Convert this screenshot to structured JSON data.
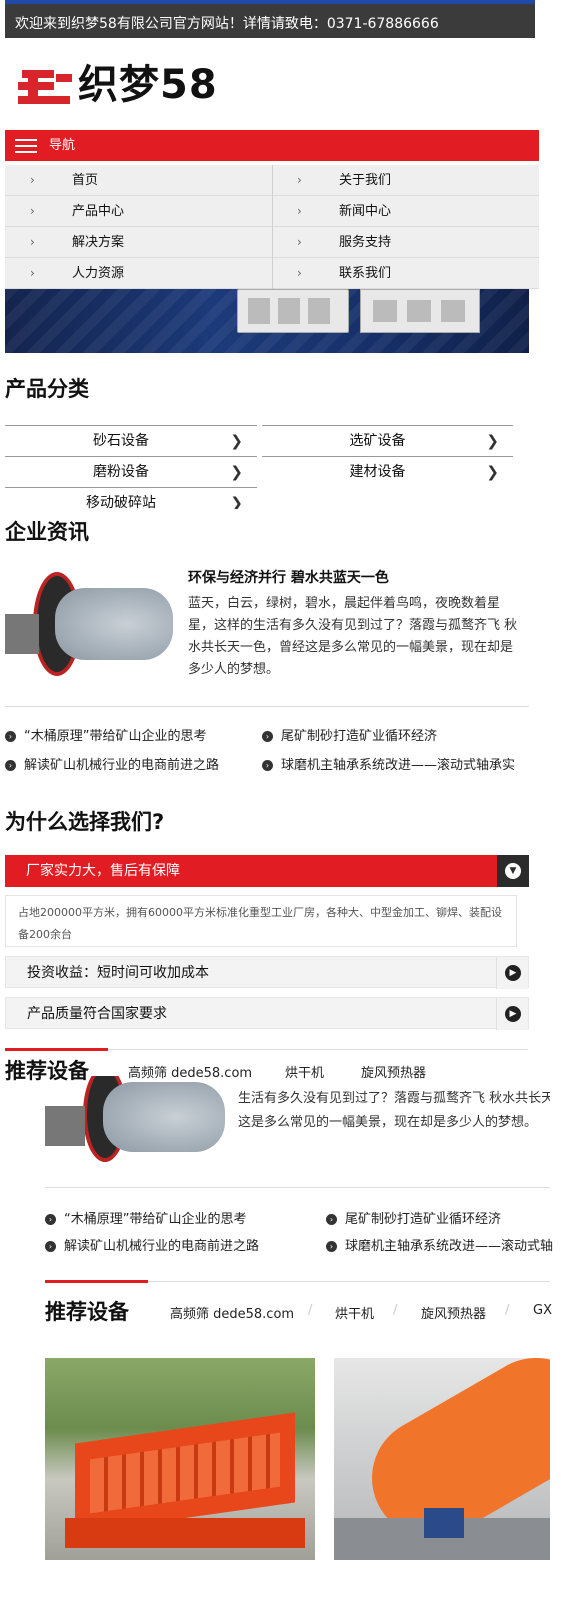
{
  "top_bar": {
    "text": "欢迎来到织梦58有限公司官方网站！详情请致电：0371-67886666"
  },
  "logo": {
    "text": "织梦58"
  },
  "nav": {
    "label": "导航",
    "items": [
      {
        "label": "首页"
      },
      {
        "label": "关于我们"
      },
      {
        "label": "产品中心"
      },
      {
        "label": "新闻中心"
      },
      {
        "label": "解决方案"
      },
      {
        "label": "服务支持"
      },
      {
        "label": "人力资源"
      },
      {
        "label": "联系我们"
      }
    ]
  },
  "product_categories": {
    "title": "产品分类",
    "items": [
      {
        "label": "砂石设备"
      },
      {
        "label": "选矿设备"
      },
      {
        "label": "磨粉设备"
      },
      {
        "label": "建材设备"
      },
      {
        "label": "移动破碎站"
      }
    ]
  },
  "news": {
    "title": "企业资讯",
    "featured_title": "环保与经济并行 碧水共蓝天一色",
    "featured_summary": "蓝天，白云，绿树，碧水，晨起伴着鸟鸣，夜晚数着星星，这样的生活有多久没有见到过了？落霞与孤鹜齐飞 秋水共长天一色，曾经这是多么常见的一幅美景，现在却是多少人的梦想。",
    "list": [
      {
        "label": "“木桶原理”带给矿山企业的思考"
      },
      {
        "label": "尾矿制砂打造矿业循环经济"
      },
      {
        "label": "解读矿山机械行业的电商前进之路"
      },
      {
        "label": "球磨机主轴承系统改进——滚动式轴承实"
      }
    ]
  },
  "why": {
    "title": "为什么选择我们?",
    "items": [
      {
        "label": "厂家实力大，售后有保障",
        "desc": "占地200000平方米，拥有60000平方米标准化重型工业厂房，各种大、中型金加工、铆焊、装配设备200余台"
      },
      {
        "label": "投资收益：短时间可收加成本"
      },
      {
        "label": "产品质量符合国家要求"
      }
    ]
  },
  "recommend_overlap": {
    "title": "推荐设备",
    "tabs": [
      {
        "label": "高频筛 dede58.com"
      },
      {
        "label": "烘干机"
      },
      {
        "label": "旋风预热器"
      }
    ],
    "summary_tail": "生活有多久没有见到过了？落霞与孤鹜齐飞 秋水共长天一",
    "summary_line2": "这是多么常见的一幅美景，现在却是多少人的梦想。",
    "list": [
      {
        "label": "“木桶原理”带给矿山企业的思考"
      },
      {
        "label": "尾矿制砂打造矿业循环经济"
      },
      {
        "label": "解读矿山机械行业的电商前进之路"
      },
      {
        "label": "球磨机主轴承系统改进——滚动式轴"
      }
    ]
  },
  "recommend": {
    "title": "推荐设备",
    "tabs": [
      {
        "label": "高频筛 dede58.com"
      },
      {
        "label": "烘干机"
      },
      {
        "label": "旋风预热器"
      },
      {
        "label": "GX"
      }
    ]
  },
  "colors": {
    "accent": "#e11d23",
    "topbar": "#3b3b3b",
    "banner": "#1c3a7a"
  }
}
